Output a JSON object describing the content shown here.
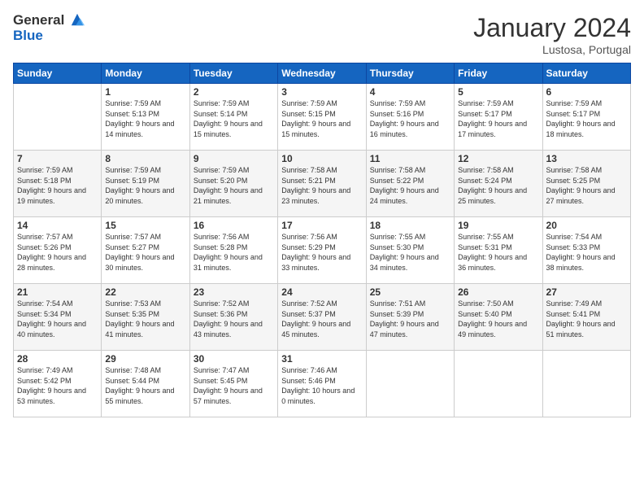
{
  "logo": {
    "general": "General",
    "blue": "Blue"
  },
  "header": {
    "month_year": "January 2024",
    "location": "Lustosa, Portugal"
  },
  "days_of_week": [
    "Sunday",
    "Monday",
    "Tuesday",
    "Wednesday",
    "Thursday",
    "Friday",
    "Saturday"
  ],
  "weeks": [
    [
      {
        "day": "",
        "sunrise": "",
        "sunset": "",
        "daylight": ""
      },
      {
        "day": "1",
        "sunrise": "Sunrise: 7:59 AM",
        "sunset": "Sunset: 5:13 PM",
        "daylight": "Daylight: 9 hours and 14 minutes."
      },
      {
        "day": "2",
        "sunrise": "Sunrise: 7:59 AM",
        "sunset": "Sunset: 5:14 PM",
        "daylight": "Daylight: 9 hours and 15 minutes."
      },
      {
        "day": "3",
        "sunrise": "Sunrise: 7:59 AM",
        "sunset": "Sunset: 5:15 PM",
        "daylight": "Daylight: 9 hours and 15 minutes."
      },
      {
        "day": "4",
        "sunrise": "Sunrise: 7:59 AM",
        "sunset": "Sunset: 5:16 PM",
        "daylight": "Daylight: 9 hours and 16 minutes."
      },
      {
        "day": "5",
        "sunrise": "Sunrise: 7:59 AM",
        "sunset": "Sunset: 5:17 PM",
        "daylight": "Daylight: 9 hours and 17 minutes."
      },
      {
        "day": "6",
        "sunrise": "Sunrise: 7:59 AM",
        "sunset": "Sunset: 5:17 PM",
        "daylight": "Daylight: 9 hours and 18 minutes."
      }
    ],
    [
      {
        "day": "7",
        "sunrise": "Sunrise: 7:59 AM",
        "sunset": "Sunset: 5:18 PM",
        "daylight": "Daylight: 9 hours and 19 minutes."
      },
      {
        "day": "8",
        "sunrise": "Sunrise: 7:59 AM",
        "sunset": "Sunset: 5:19 PM",
        "daylight": "Daylight: 9 hours and 20 minutes."
      },
      {
        "day": "9",
        "sunrise": "Sunrise: 7:59 AM",
        "sunset": "Sunset: 5:20 PM",
        "daylight": "Daylight: 9 hours and 21 minutes."
      },
      {
        "day": "10",
        "sunrise": "Sunrise: 7:58 AM",
        "sunset": "Sunset: 5:21 PM",
        "daylight": "Daylight: 9 hours and 23 minutes."
      },
      {
        "day": "11",
        "sunrise": "Sunrise: 7:58 AM",
        "sunset": "Sunset: 5:22 PM",
        "daylight": "Daylight: 9 hours and 24 minutes."
      },
      {
        "day": "12",
        "sunrise": "Sunrise: 7:58 AM",
        "sunset": "Sunset: 5:24 PM",
        "daylight": "Daylight: 9 hours and 25 minutes."
      },
      {
        "day": "13",
        "sunrise": "Sunrise: 7:58 AM",
        "sunset": "Sunset: 5:25 PM",
        "daylight": "Daylight: 9 hours and 27 minutes."
      }
    ],
    [
      {
        "day": "14",
        "sunrise": "Sunrise: 7:57 AM",
        "sunset": "Sunset: 5:26 PM",
        "daylight": "Daylight: 9 hours and 28 minutes."
      },
      {
        "day": "15",
        "sunrise": "Sunrise: 7:57 AM",
        "sunset": "Sunset: 5:27 PM",
        "daylight": "Daylight: 9 hours and 30 minutes."
      },
      {
        "day": "16",
        "sunrise": "Sunrise: 7:56 AM",
        "sunset": "Sunset: 5:28 PM",
        "daylight": "Daylight: 9 hours and 31 minutes."
      },
      {
        "day": "17",
        "sunrise": "Sunrise: 7:56 AM",
        "sunset": "Sunset: 5:29 PM",
        "daylight": "Daylight: 9 hours and 33 minutes."
      },
      {
        "day": "18",
        "sunrise": "Sunrise: 7:55 AM",
        "sunset": "Sunset: 5:30 PM",
        "daylight": "Daylight: 9 hours and 34 minutes."
      },
      {
        "day": "19",
        "sunrise": "Sunrise: 7:55 AM",
        "sunset": "Sunset: 5:31 PM",
        "daylight": "Daylight: 9 hours and 36 minutes."
      },
      {
        "day": "20",
        "sunrise": "Sunrise: 7:54 AM",
        "sunset": "Sunset: 5:33 PM",
        "daylight": "Daylight: 9 hours and 38 minutes."
      }
    ],
    [
      {
        "day": "21",
        "sunrise": "Sunrise: 7:54 AM",
        "sunset": "Sunset: 5:34 PM",
        "daylight": "Daylight: 9 hours and 40 minutes."
      },
      {
        "day": "22",
        "sunrise": "Sunrise: 7:53 AM",
        "sunset": "Sunset: 5:35 PM",
        "daylight": "Daylight: 9 hours and 41 minutes."
      },
      {
        "day": "23",
        "sunrise": "Sunrise: 7:52 AM",
        "sunset": "Sunset: 5:36 PM",
        "daylight": "Daylight: 9 hours and 43 minutes."
      },
      {
        "day": "24",
        "sunrise": "Sunrise: 7:52 AM",
        "sunset": "Sunset: 5:37 PM",
        "daylight": "Daylight: 9 hours and 45 minutes."
      },
      {
        "day": "25",
        "sunrise": "Sunrise: 7:51 AM",
        "sunset": "Sunset: 5:39 PM",
        "daylight": "Daylight: 9 hours and 47 minutes."
      },
      {
        "day": "26",
        "sunrise": "Sunrise: 7:50 AM",
        "sunset": "Sunset: 5:40 PM",
        "daylight": "Daylight: 9 hours and 49 minutes."
      },
      {
        "day": "27",
        "sunrise": "Sunrise: 7:49 AM",
        "sunset": "Sunset: 5:41 PM",
        "daylight": "Daylight: 9 hours and 51 minutes."
      }
    ],
    [
      {
        "day": "28",
        "sunrise": "Sunrise: 7:49 AM",
        "sunset": "Sunset: 5:42 PM",
        "daylight": "Daylight: 9 hours and 53 minutes."
      },
      {
        "day": "29",
        "sunrise": "Sunrise: 7:48 AM",
        "sunset": "Sunset: 5:44 PM",
        "daylight": "Daylight: 9 hours and 55 minutes."
      },
      {
        "day": "30",
        "sunrise": "Sunrise: 7:47 AM",
        "sunset": "Sunset: 5:45 PM",
        "daylight": "Daylight: 9 hours and 57 minutes."
      },
      {
        "day": "31",
        "sunrise": "Sunrise: 7:46 AM",
        "sunset": "Sunset: 5:46 PM",
        "daylight": "Daylight: 10 hours and 0 minutes."
      },
      {
        "day": "",
        "sunrise": "",
        "sunset": "",
        "daylight": ""
      },
      {
        "day": "",
        "sunrise": "",
        "sunset": "",
        "daylight": ""
      },
      {
        "day": "",
        "sunrise": "",
        "sunset": "",
        "daylight": ""
      }
    ]
  ]
}
